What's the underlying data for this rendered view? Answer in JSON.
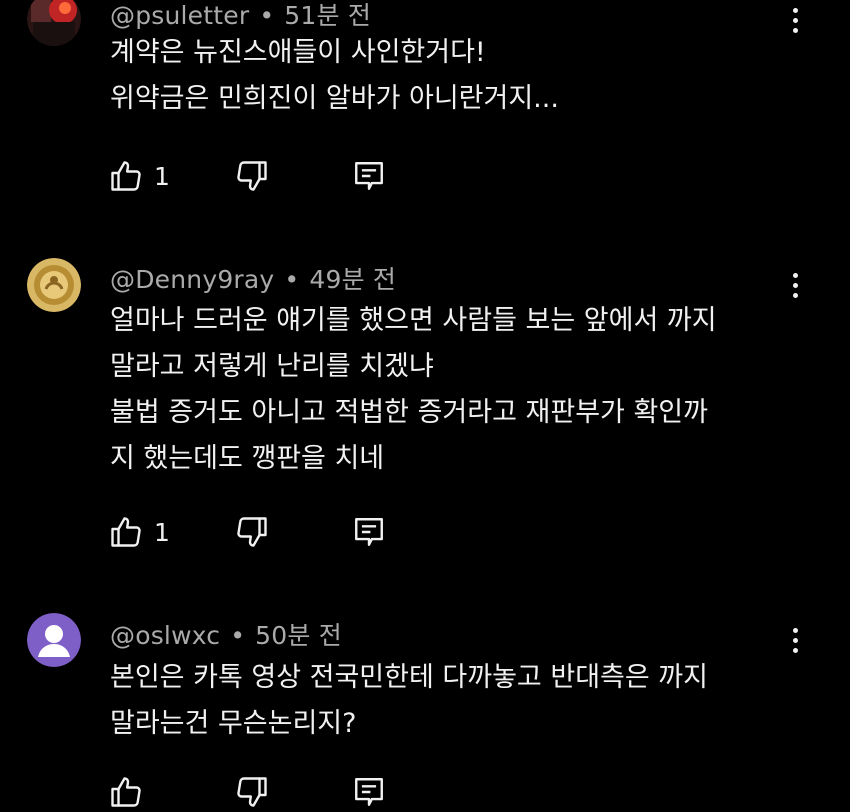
{
  "comments": [
    {
      "handle": "@psuletter",
      "time": "51분 전",
      "lines": [
        "계약은 뉴진스애들이 사인한거다!",
        "위약금은 민희진이 알바가 아니란거지..."
      ],
      "likes": "1",
      "avatar_color": "#7a1f1f"
    },
    {
      "handle": "@Denny9ray",
      "time": "49분 전",
      "lines": [
        "얼마나 드러운 얘기를 했으면 사람들 보는 앞에서 까지",
        "말라고 저렇게 난리를 치겠냐",
        "불법 증거도 아니고 적법한 증거라고 재판부가 확인까",
        "지 했는데도 깽판을 치네"
      ],
      "likes": "1",
      "avatar_color": "#c9a34a"
    },
    {
      "handle": "@oslwxc",
      "time": "50분 전",
      "lines": [
        "본인은 카톡 영상 전국민한테 다까놓고 반대측은 까지",
        "말라는건 무슨논리지?"
      ],
      "likes": "",
      "avatar_color": "#7e5fc8"
    }
  ],
  "separator": "•",
  "icons": {
    "like": "thumb-up-icon",
    "dislike": "thumb-down-icon",
    "reply": "reply-icon",
    "menu": "more-vert-icon"
  },
  "colors": {
    "background": "#000000",
    "text": "#f1f1f1",
    "meta": "#aaaaaa"
  }
}
